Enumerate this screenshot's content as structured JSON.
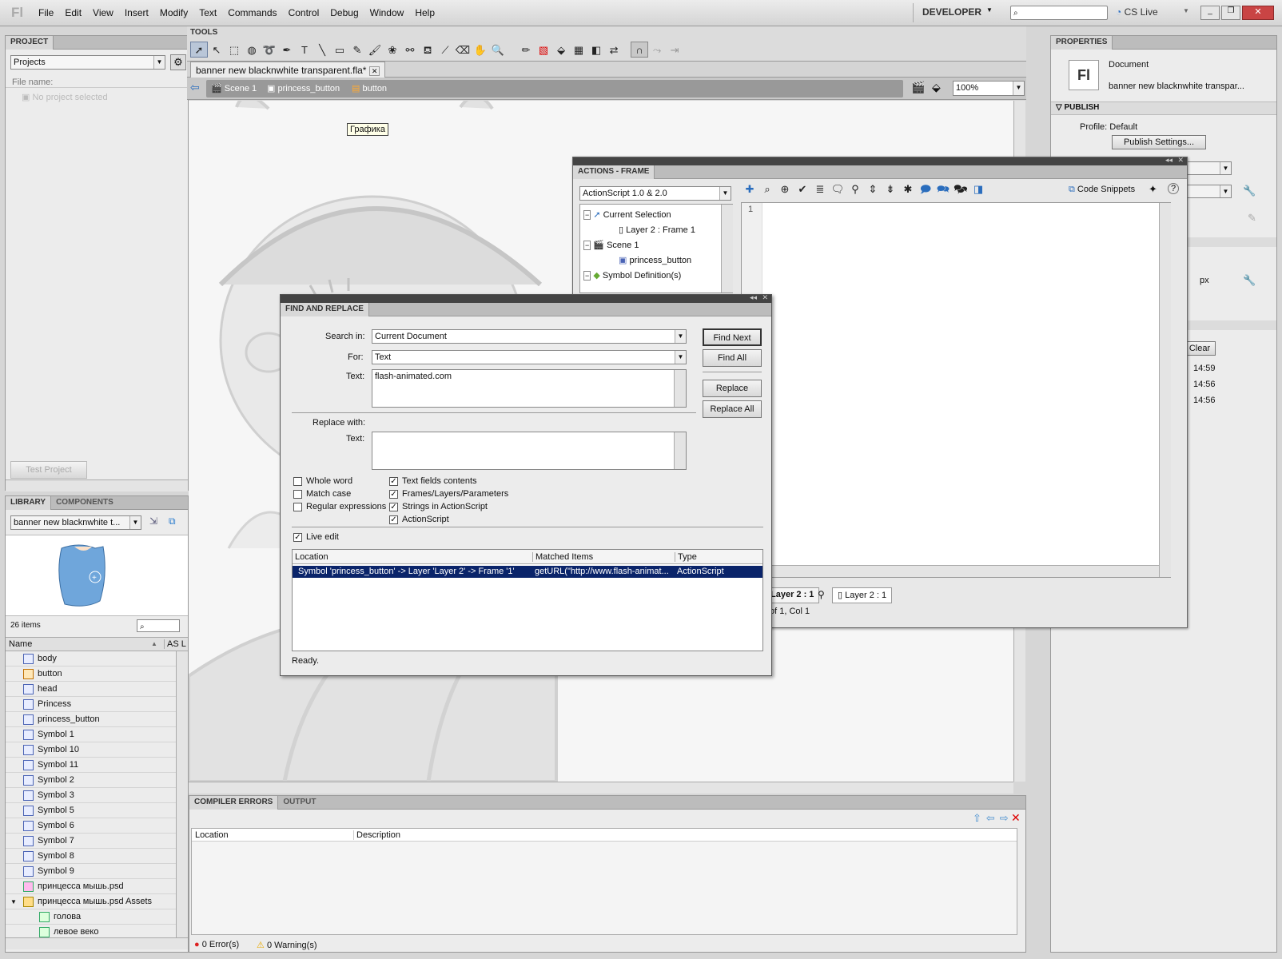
{
  "app": {
    "logo": "Fl",
    "workspace": "DEVELOPER",
    "cslive": "CS Live"
  },
  "menu": [
    "File",
    "Edit",
    "View",
    "Insert",
    "Modify",
    "Text",
    "Commands",
    "Control",
    "Debug",
    "Window",
    "Help"
  ],
  "project": {
    "title": "PROJECT",
    "dropdown": "Projects",
    "file_name_label": "File name:",
    "no_project": "No project selected",
    "test_btn": "Test Project"
  },
  "library": {
    "tabs": [
      "LIBRARY",
      "COMPONENTS"
    ],
    "doc": "banner new blacknwhite t...",
    "count": "26 items",
    "col_name": "Name",
    "col_as": "AS L",
    "items": [
      "body",
      "button",
      "head",
      "Princess",
      "princess_button",
      "Symbol 1",
      "Symbol 10",
      "Symbol 11",
      "Symbol 2",
      "Symbol 3",
      "Symbol 5",
      "Symbol 6",
      "Symbol 7",
      "Symbol 8",
      "Symbol 9",
      "принцесса мышь.psd",
      "принцесса мышь.psd Assets",
      "голова",
      "левое веко"
    ]
  },
  "tools": {
    "title": "TOOLS"
  },
  "document": {
    "tab": "banner new blacknwhite transparent.fla*",
    "crumbs": [
      "Scene 1",
      "princess_button",
      "button"
    ],
    "zoom": "100%",
    "tooltip": "Графика"
  },
  "properties": {
    "title": "PROPERTIES",
    "doc_type": "Document",
    "doc_name": "banner new blacknwhite transpar...",
    "publish": "PUBLISH",
    "profile": "Profile: Default",
    "publish_settings": "Publish Settings...",
    "px": "px",
    "clear": "Clear",
    "times": [
      "14:59",
      "14:56",
      "14:56"
    ]
  },
  "actions": {
    "title": "ACTIONS - FRAME",
    "version": "ActionScript 1.0 & 2.0",
    "code_snippets": "Code Snippets",
    "line1": "1",
    "tree": [
      "Current Selection",
      "Layer 2 : Frame 1",
      "Scene 1",
      "princess_button",
      "Symbol Definition(s)"
    ],
    "status_tab1": "Layer 2 : 1",
    "status_tab2": "Layer 2 : 1",
    "position": "of 1, Col 1"
  },
  "find": {
    "title": "FIND AND REPLACE",
    "search_in_label": "Search in:",
    "search_in": "Current Document",
    "for_label": "For:",
    "for": "Text",
    "text_label": "Text:",
    "text": "flash-animated.com",
    "replace_with": "Replace with:",
    "replace_text_label": "Text:",
    "find_next": "Find Next",
    "find_all": "Find All",
    "replace": "Replace",
    "replace_all": "Replace All",
    "opts_left": [
      "Whole word",
      "Match case",
      "Regular expressions"
    ],
    "opts_right": [
      "Text fields contents",
      "Frames/Layers/Parameters",
      "Strings in ActionScript",
      "ActionScript"
    ],
    "live_edit": "Live edit",
    "cols": [
      "Location",
      "Matched Items",
      "Type"
    ],
    "row": [
      "Symbol 'princess_button' -> Layer 'Layer 2' -> Frame '1'",
      "getURL(\"http://www.flash-animat...",
      "ActionScript"
    ],
    "status": "Ready."
  },
  "compiler": {
    "tabs": [
      "COMPILER ERRORS",
      "OUTPUT"
    ],
    "cols": [
      "Location",
      "Description"
    ],
    "errors": "0 Error(s)",
    "warnings": "0 Warning(s)"
  }
}
